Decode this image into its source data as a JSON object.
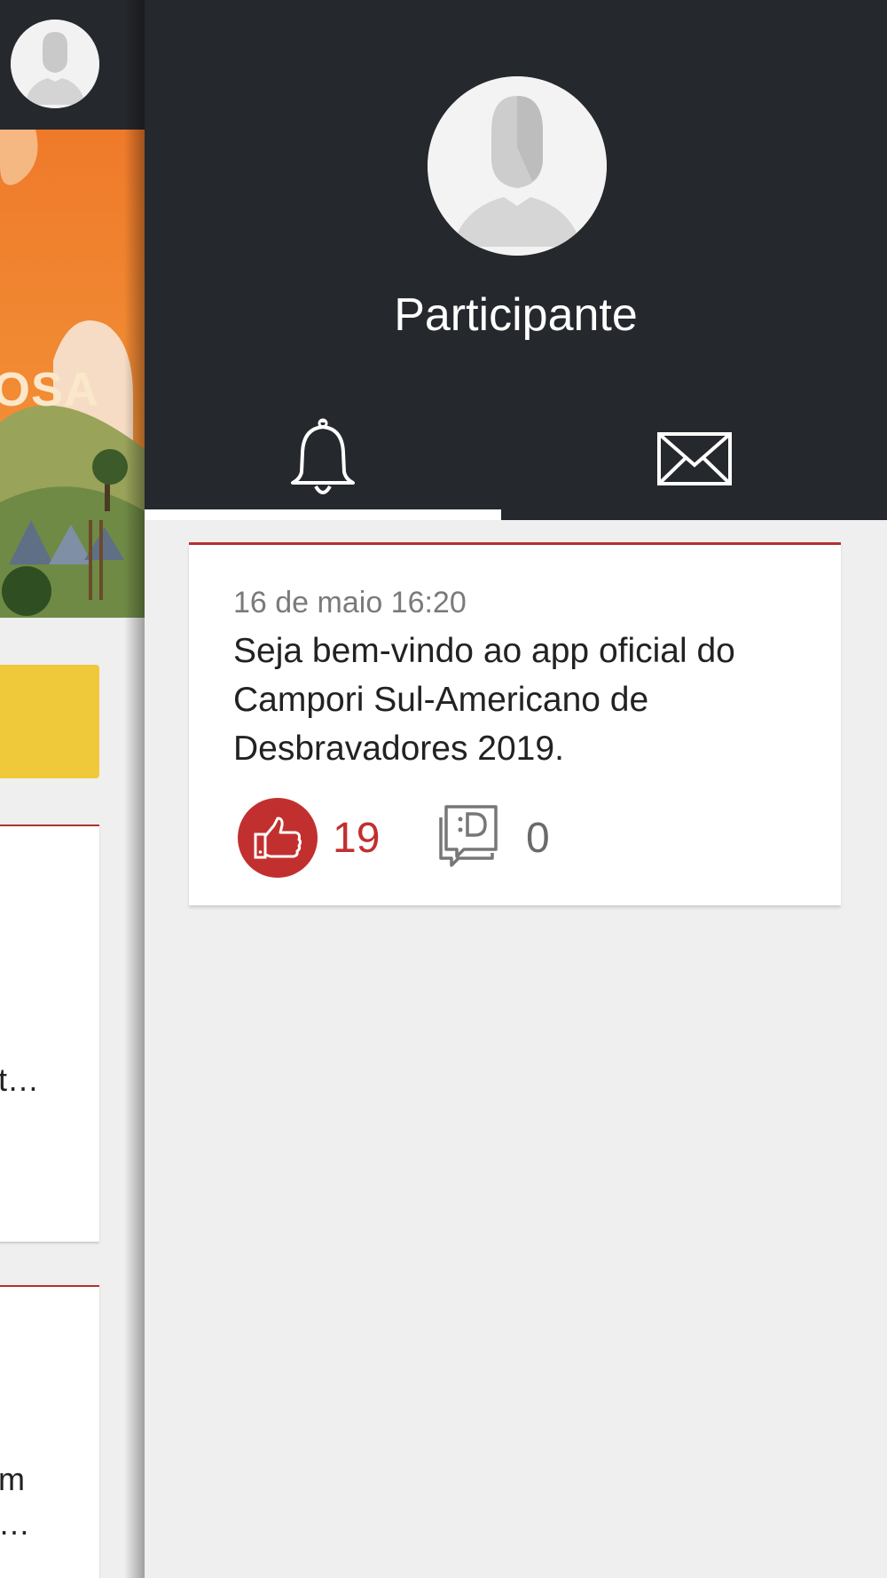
{
  "background_screen": {
    "banner_text": "OSA",
    "card1_snippet": "t…",
    "card2_snippet_line1": "m",
    "card2_snippet_line2": "…"
  },
  "drawer": {
    "profile_name": "Participante",
    "tabs": [
      {
        "icon": "bell-icon",
        "active": true
      },
      {
        "icon": "envelope-icon",
        "active": false
      }
    ],
    "notifications": [
      {
        "date": "16 de maio 16:20",
        "text": "Seja bem-vindo ao app oficial do Campori Sul-Americano de Desbravadores 2019.",
        "likes": "19",
        "comments": "0"
      }
    ]
  },
  "colors": {
    "header_bg": "#25282c",
    "accent_red": "#c1302e",
    "page_bg": "#efefef",
    "yellow_button": "#f0c93a"
  }
}
